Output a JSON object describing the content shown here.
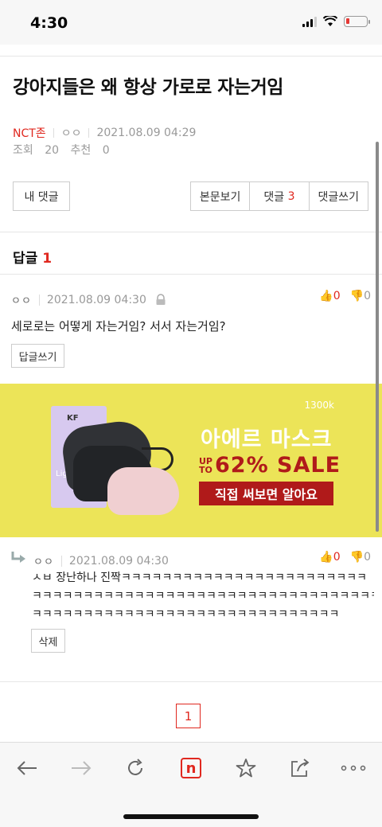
{
  "status_bar": {
    "time": "4:30"
  },
  "post": {
    "title": "강아지들은 왜 항상 가로로 자는거임",
    "board": "NCT존",
    "author": "ㅇㅇ",
    "datetime": "2021.08.09 04:29",
    "views_label": "조회",
    "views": "20",
    "recommend_label": "추천",
    "recommend": "0"
  },
  "buttons": {
    "my_comments": "내 댓글",
    "view_body": "본문보기",
    "comments": "댓글",
    "comments_count": "3",
    "write_comment": "댓글쓰기"
  },
  "replies": {
    "label": "답글",
    "count": "1"
  },
  "comments": [
    {
      "author": "ㅇㅇ",
      "datetime": "2021.08.09 04:30",
      "up": "0",
      "down": "0",
      "text": "세로로는 어떻게 자는거임? 서서 자는거임?",
      "action": "답글쓰기"
    },
    {
      "author": "ㅇㅇ",
      "datetime": "2021.08.09 04:30",
      "up": "0",
      "down": "0",
      "text_lines": [
        "ㅅㅂ 장난하나 진짝ㅋㅋㅋㅋㅋㅋㅋㅋㅋㅋㅋㅋㅋㅋㅋㅋㅋㅋㅋㅋㅋㅋㅋㅋ",
        "ㅋㅋㅋㅋㅋㅋㅋㅋㅋㅋㅋㅋㅋㅋㅋㅋㅋㅋㅋㅋㅋㅋㅋㅋㅋㅋㅋㅋㅋㅋㅋㅋㅋㅋ",
        "ㅋㅋㅋㅋㅋㅋㅋㅋㅋㅋㅋㅋㅋㅋㅋㅋㅋㅋㅋㅋㅋㅋㅋㅋㅋㅋㅋㅋㅋㅋ"
      ],
      "action": "삭제"
    }
  ],
  "ad": {
    "brand": "1300k",
    "product_box": "KF",
    "box_label": "Light",
    "headline": "아에르 마스크",
    "upto": [
      "UP",
      "TO"
    ],
    "sale": "62% SALE",
    "cta": "직접 써보면 알아요"
  },
  "pagination": {
    "current": "1"
  },
  "colors": {
    "accent": "#e0281f",
    "ad_bg": "#ece458",
    "ad_red": "#b01a1a"
  },
  "browser": {
    "icons": [
      "back-arrow-icon",
      "forward-arrow-icon",
      "reload-icon",
      "naver-logo-icon",
      "star-icon",
      "share-icon",
      "more-icon"
    ],
    "logo_letter": "n"
  }
}
